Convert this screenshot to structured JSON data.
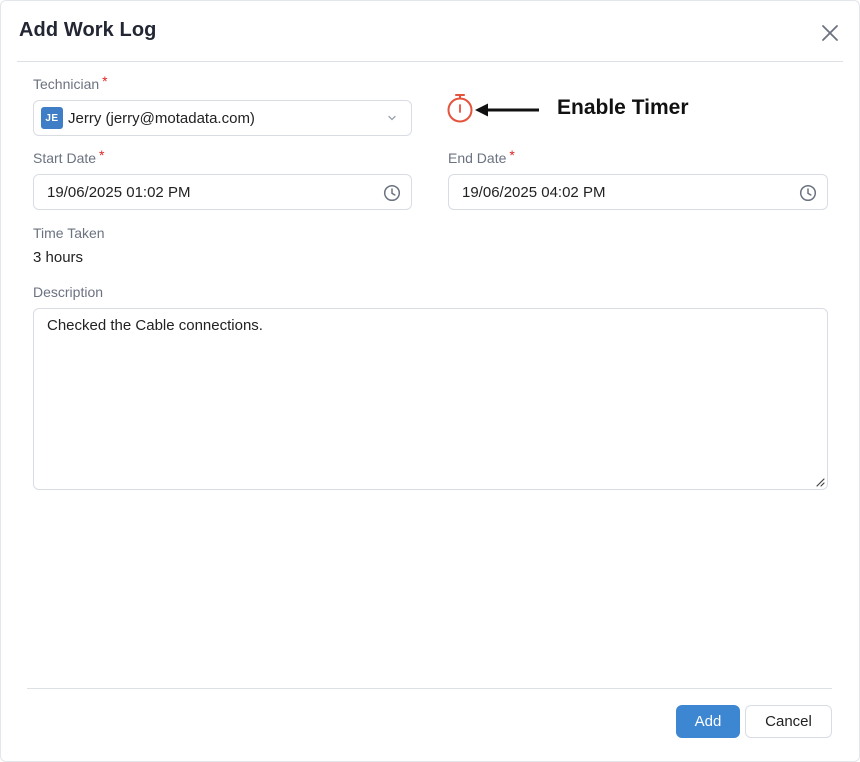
{
  "dialog": {
    "title": "Add Work Log",
    "close_icon": "close-icon"
  },
  "technician": {
    "label": "Technician",
    "required_mark": "*",
    "avatar_initials": "JE",
    "value": "Jerry (jerry@motadata.com)"
  },
  "timer": {
    "icon": "stopwatch-icon",
    "annotation": "Enable Timer",
    "color": "#e5533d"
  },
  "start_date": {
    "label": "Start Date",
    "required_mark": "*",
    "value": "19/06/2025 01:02 PM"
  },
  "end_date": {
    "label": "End Date",
    "required_mark": "*",
    "value": "19/06/2025 04:02 PM"
  },
  "time_taken": {
    "label": "Time Taken",
    "value": "3 hours"
  },
  "description": {
    "label": "Description",
    "value": "Checked the Cable connections."
  },
  "footer": {
    "add_label": "Add",
    "cancel_label": "Cancel"
  },
  "colors": {
    "accent": "#3d86d1",
    "required": "#e02424"
  }
}
